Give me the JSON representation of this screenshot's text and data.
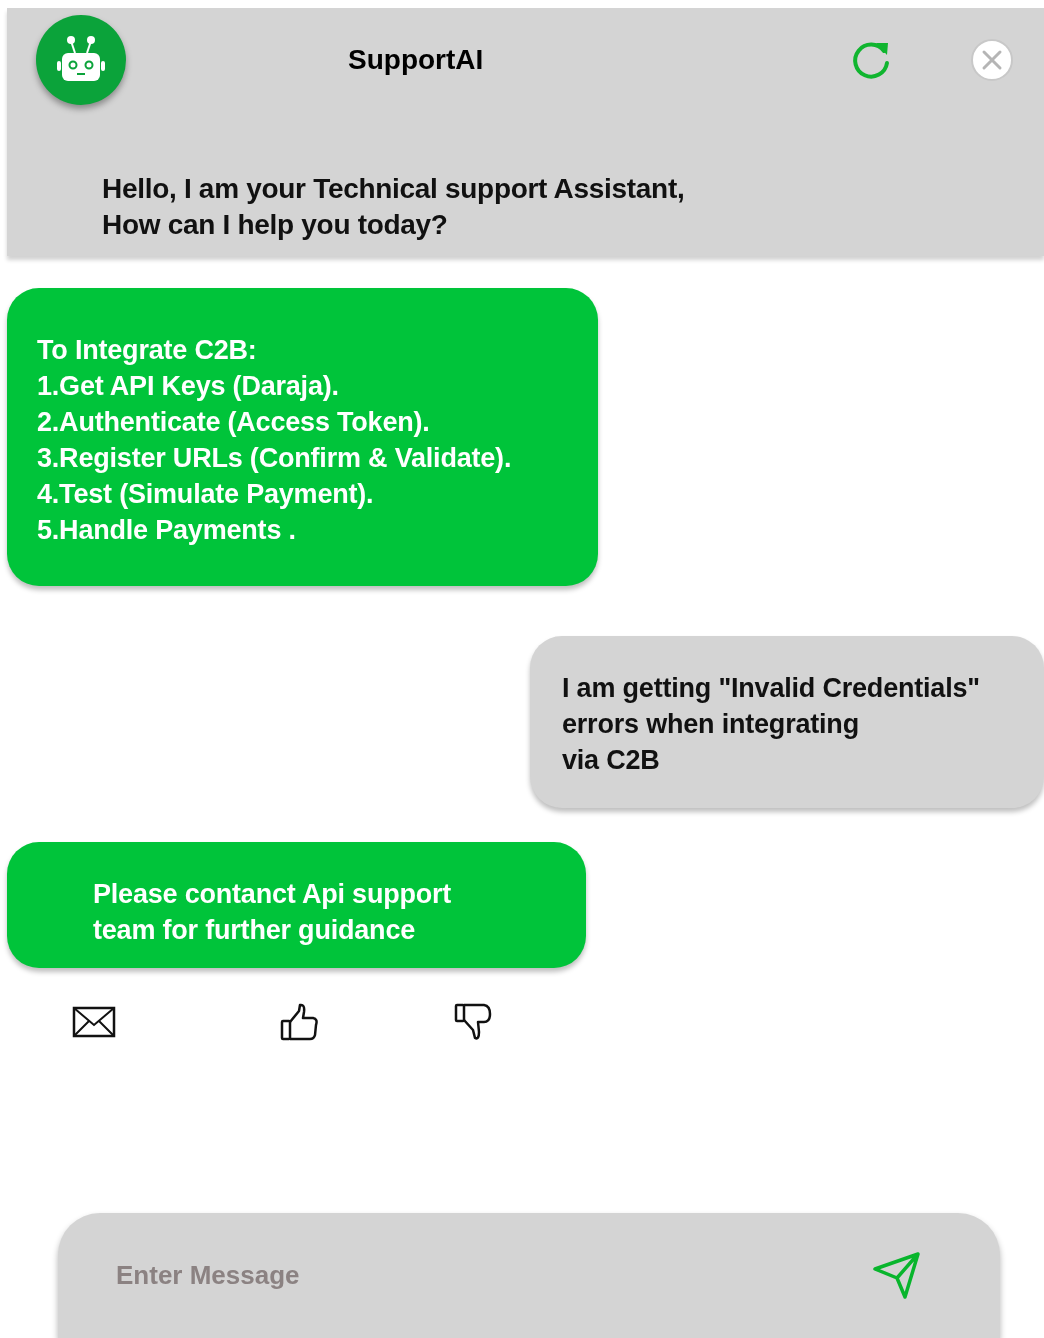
{
  "header": {
    "title": "SupportAI",
    "greeting": "Hello, I am  your  Technical support Assistant,\nHow can I help you today?"
  },
  "messages": [
    {
      "kind": "bot",
      "text": "To Integrate C2B:\n1.Get API Keys (Daraja).\n2.Authenticate (Access Token).\n3.Register URLs (Confirm & Validate).\n4.Test (Simulate Payment).\n5.Handle Payments ."
    },
    {
      "kind": "user",
      "text": "I am getting \"Invalid Credentials\"\nerrors when integrating\nvia  C2B"
    },
    {
      "kind": "bot",
      "text": "Please contanct Api support\nteam for further guidance",
      "feedback": true
    }
  ],
  "composer": {
    "placeholder": "Enter Message"
  }
}
